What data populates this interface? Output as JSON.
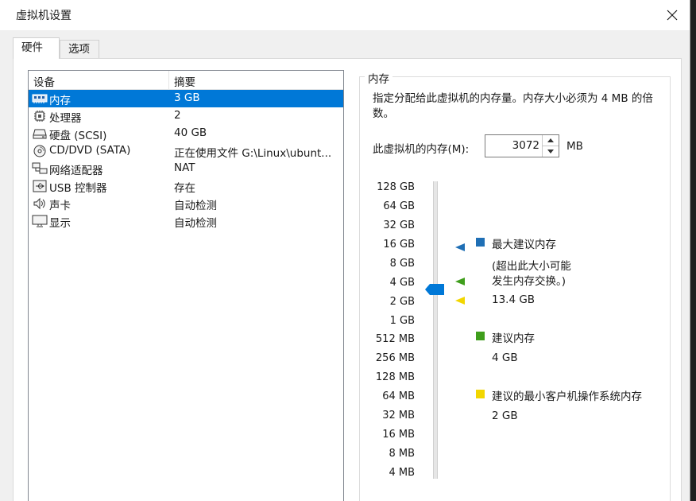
{
  "window": {
    "title": "虚拟机设置"
  },
  "tabs": [
    {
      "label": "硬件"
    },
    {
      "label": "选项"
    }
  ],
  "device_list": {
    "headers": {
      "device": "设备",
      "summary": "摘要"
    },
    "rows": [
      {
        "icon": "memory-icon",
        "name": "内存",
        "summary": "3 GB",
        "selected": true
      },
      {
        "icon": "processor-icon",
        "name": "处理器",
        "summary": "2"
      },
      {
        "icon": "hard-disk-icon",
        "name": "硬盘 (SCSI)",
        "summary": "40 GB"
      },
      {
        "icon": "cd-dvd-icon",
        "name": "CD/DVD (SATA)",
        "summary": "正在使用文件 G:\\Linux\\ubunt..."
      },
      {
        "icon": "network-adapter-icon",
        "name": "网络适配器",
        "summary": "NAT"
      },
      {
        "icon": "usb-icon",
        "name": "USB 控制器",
        "summary": "存在"
      },
      {
        "icon": "sound-card-icon",
        "name": "声卡",
        "summary": "自动检测"
      },
      {
        "icon": "display-icon",
        "name": "显示",
        "summary": "自动检测"
      }
    ]
  },
  "memory": {
    "group_title": "内存",
    "description": "指定分配给此虚拟机的内存量。内存大小必须为 4 MB 的倍数。",
    "field_label": "此虚拟机的内存(M):",
    "value": "3072",
    "unit": "MB",
    "slider_value_mb": 3072,
    "ticks": [
      "128 GB",
      "64 GB",
      "32 GB",
      "16 GB",
      "8 GB",
      "4 GB",
      "2 GB",
      "1 GB",
      "512 MB",
      "256 MB",
      "128 MB",
      "64 MB",
      "32 MB",
      "16 MB",
      "8 MB",
      "4 MB"
    ],
    "legend": {
      "max": {
        "label": "最大建议内存",
        "note_line1": "(超出此大小可能",
        "note_line2": "发生内存交换。)",
        "value": "13.4 GB",
        "color": "#1f6fb5"
      },
      "recommended": {
        "label": "建议内存",
        "value": "4 GB",
        "color": "#3f9e1c"
      },
      "min": {
        "label": "建议的最小客户机操作系统内存",
        "value": "2 GB",
        "color": "#f2d600"
      }
    },
    "slider_color": "#0078d7"
  }
}
